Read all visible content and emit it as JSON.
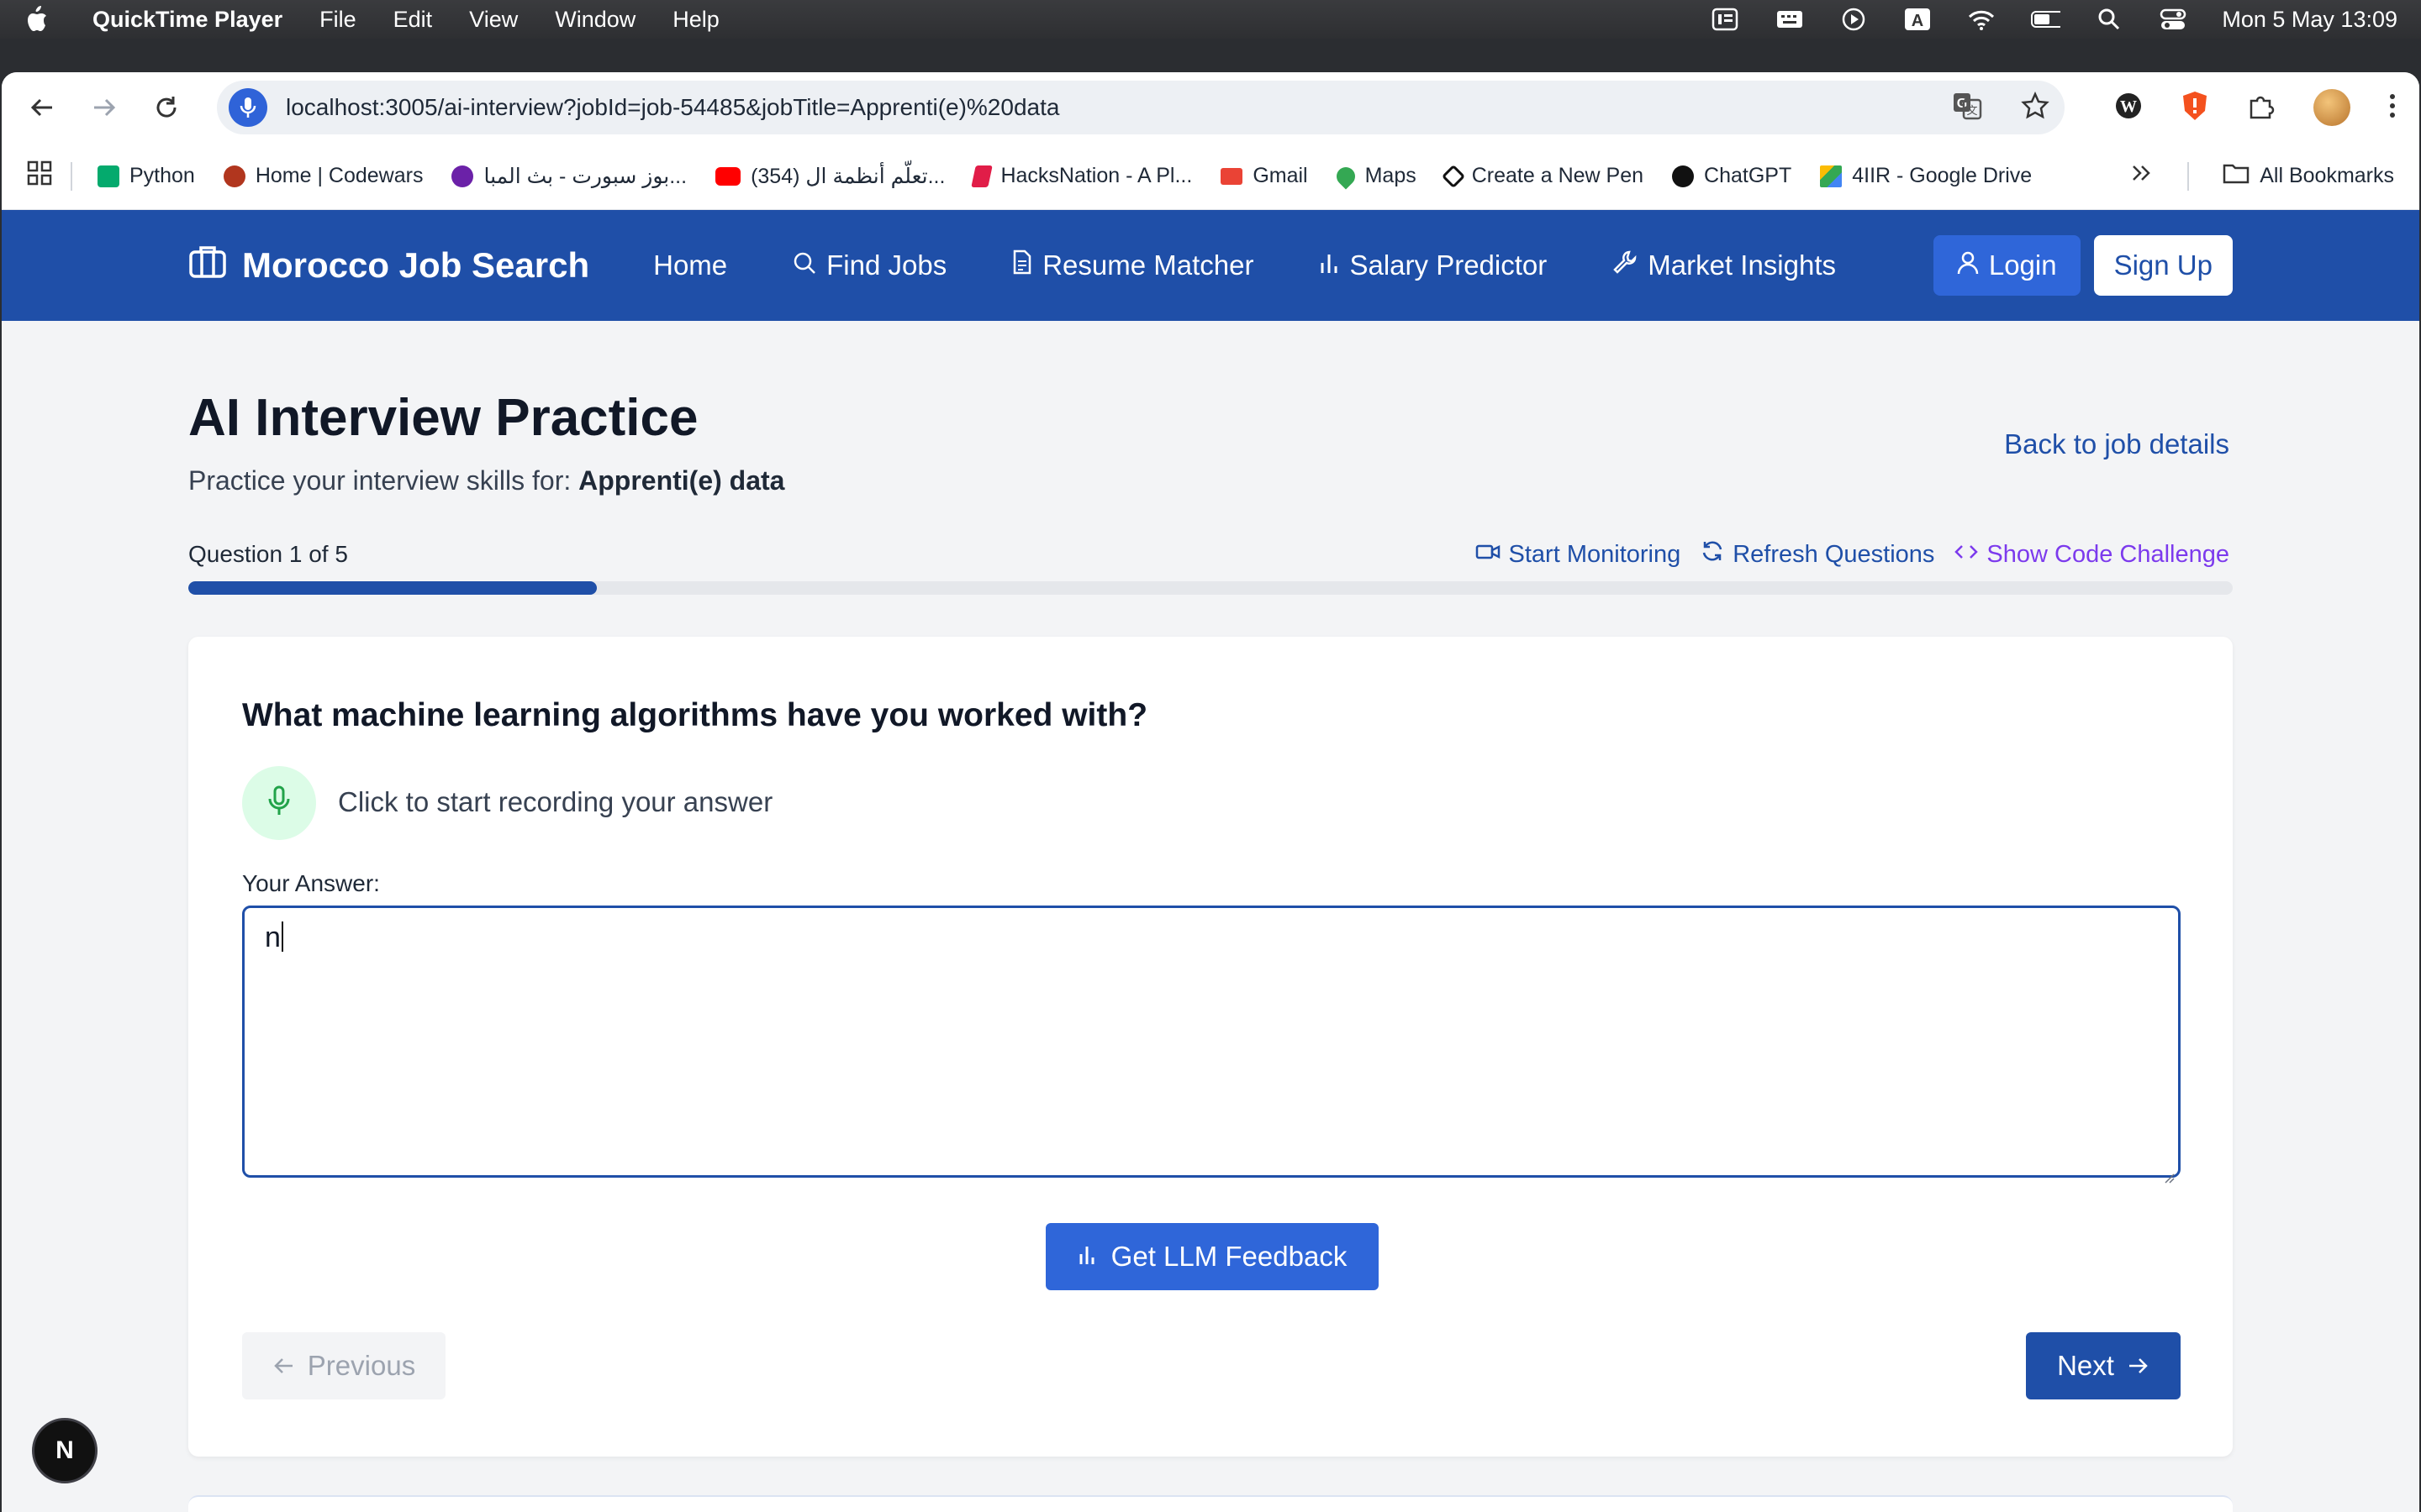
{
  "menubar": {
    "app_name": "QuickTime Player",
    "items": [
      "File",
      "Edit",
      "View",
      "Window",
      "Help"
    ],
    "clock": "Mon 5 May  13:09"
  },
  "browser": {
    "url": "localhost:3005/ai-interview?jobId=job-54485&jobTitle=Apprenti(e)%20data",
    "bookmarks": [
      {
        "label": "Python",
        "icon": "w3-icon",
        "color": "#04aa6d"
      },
      {
        "label": "Home | Codewars",
        "icon": "codewars-icon",
        "color": "#b1361e"
      },
      {
        "label": "بوز سبورت - بث المبا...",
        "icon": "sport-icon",
        "color": "#6b21a8"
      },
      {
        "label": "(354) تعلّم أنظمة ال...",
        "icon": "youtube-icon",
        "color": "#ff0000"
      },
      {
        "label": "HacksNation - A Pl...",
        "icon": "hacksnation-icon",
        "color": "#e11d48"
      },
      {
        "label": "Gmail",
        "icon": "gmail-icon",
        "color": "#ea4335"
      },
      {
        "label": "Maps",
        "icon": "maps-icon",
        "color": "#34a853"
      },
      {
        "label": "Create a New Pen",
        "icon": "codepen-icon",
        "color": "#111111"
      },
      {
        "label": "ChatGPT",
        "icon": "chatgpt-icon",
        "color": "#111111"
      },
      {
        "label": "4IIR - Google Drive",
        "icon": "drive-icon",
        "color": "#fbbc04"
      }
    ],
    "all_bookmarks": "All Bookmarks"
  },
  "header": {
    "brand": "Morocco Job Search",
    "nav": {
      "home": "Home",
      "find_jobs": "Find Jobs",
      "resume_matcher": "Resume Matcher",
      "salary_predictor": "Salary Predictor",
      "market_insights": "Market Insights"
    },
    "login": "Login",
    "signup": "Sign Up"
  },
  "page": {
    "title": "AI Interview Practice",
    "subtitle_prefix": "Practice your interview skills for: ",
    "job_title": "Apprenti(e) data",
    "back_link": "Back to job details",
    "question_counter": "Question 1 of 5",
    "progress_fraction": 0.2,
    "tools": {
      "monitoring": "Start Monitoring",
      "refresh": "Refresh Questions",
      "code": "Show Code Challenge"
    }
  },
  "card": {
    "question": "What machine learning algorithms have you worked with?",
    "record_prompt": "Click to start recording your answer",
    "answer_label": "Your Answer:",
    "answer_value": "n",
    "feedback_button": "Get LLM Feedback",
    "previous_button": "Previous",
    "next_button": "Next"
  },
  "dev_badge": "N",
  "colors": {
    "primary": "#1f4fa8",
    "button_blue": "#2f66d9",
    "code_link": "#7c3aed",
    "mic_bg": "#dcfce7",
    "mic_icon": "#22a34a"
  }
}
